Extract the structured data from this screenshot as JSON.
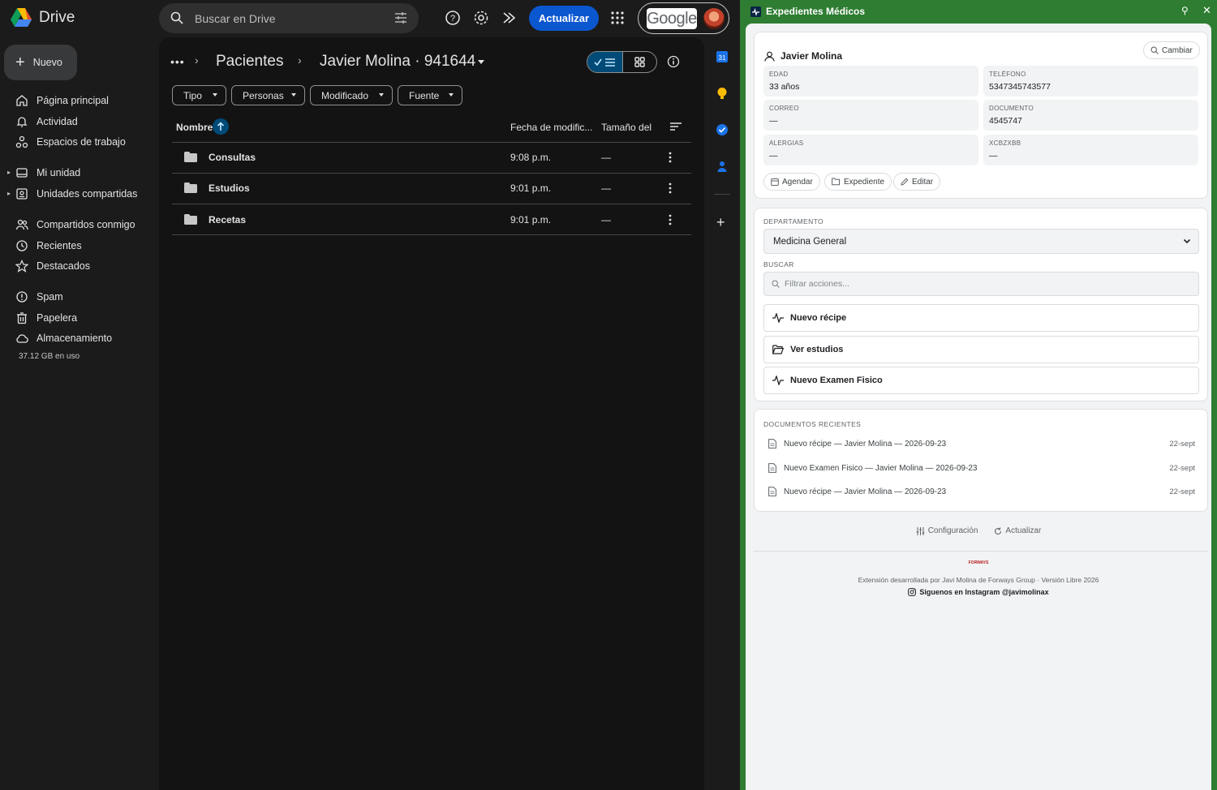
{
  "drive": {
    "app_name": "Drive",
    "search_placeholder": "Buscar en Drive",
    "update_button": "Actualizar",
    "account_label": "Google",
    "new_button": "Nuevo",
    "nav": [
      {
        "label": "Página principal",
        "icon": "home-icon"
      },
      {
        "label": "Actividad",
        "icon": "bell-icon"
      },
      {
        "label": "Espacios de trabajo",
        "icon": "workspaces-icon"
      },
      {
        "label": "Mi unidad",
        "icon": "my-drive-icon"
      },
      {
        "label": "Unidades compartidas",
        "icon": "shared-drives-icon"
      },
      {
        "label": "Compartidos conmigo",
        "icon": "people-icon"
      },
      {
        "label": "Recientes",
        "icon": "clock-icon"
      },
      {
        "label": "Destacados",
        "icon": "star-icon"
      },
      {
        "label": "Spam",
        "icon": "spam-icon"
      },
      {
        "label": "Papelera",
        "icon": "trash-icon"
      },
      {
        "label": "Almacenamiento",
        "icon": "cloud-icon"
      }
    ],
    "storage_used": "37.12 GB en uso",
    "breadcrumb": {
      "parent": "Pacientes",
      "current": "Javier Molina · 941644"
    },
    "filters": [
      "Tipo",
      "Personas",
      "Modificado",
      "Fuente"
    ],
    "columns": {
      "name": "Nombre",
      "modified": "Fecha de modific...",
      "size": "Tamaño del a"
    },
    "files": [
      {
        "name": "Consultas",
        "modified": "9:08 p.m.",
        "size": "—"
      },
      {
        "name": "Estudios",
        "modified": "9:01 p.m.",
        "size": "—"
      },
      {
        "name": "Recetas",
        "modified": "9:01 p.m.",
        "size": "—"
      }
    ]
  },
  "panel": {
    "title": "Expedientes Médicos",
    "patient": {
      "name": "Javier Molina",
      "change_button": "Cambiar",
      "fields": [
        {
          "label": "EDAD",
          "value": "33 años"
        },
        {
          "label": "TELÉFONO",
          "value": "5347345743577"
        },
        {
          "label": "CORREO",
          "value": "—"
        },
        {
          "label": "DOCUMENTO",
          "value": "4545747"
        },
        {
          "label": "ALERGIAS",
          "value": "—"
        },
        {
          "label": "XCBZXBB",
          "value": "—"
        }
      ],
      "actions": [
        "Agendar",
        "Expediente",
        "Editar"
      ]
    },
    "department_label": "DEPARTAMENTO",
    "department_value": "Medicina General",
    "search_label": "BUSCAR",
    "search_placeholder": "Filtrar acciones...",
    "actions": [
      {
        "label": "Nuevo récipe",
        "icon": "pulse-icon"
      },
      {
        "label": "Ver estudios",
        "icon": "folder-open-icon"
      },
      {
        "label": "Nuevo Examen Fisico",
        "icon": "pulse-icon"
      }
    ],
    "recent_label": "DOCUMENTOS RECIENTES",
    "recent_docs": [
      {
        "name": "Nuevo récipe — Javier Molina — 2026-09-23",
        "date": "22-sept"
      },
      {
        "name": "Nuevo Examen Fisico — Javier Molina — 2026-09-23",
        "date": "22-sept"
      },
      {
        "name": "Nuevo récipe — Javier Molina — 2026-09-23",
        "date": "22-sept"
      }
    ],
    "footer": {
      "config": "Configuración",
      "refresh": "Actualizar",
      "brand": "FORWAYS",
      "credits": "Extensión desarrollada por Javi Molina de Forways Group · Versión Libre 2026",
      "instagram": "Siguenos en Instagram @javimolinax"
    }
  },
  "colors": {
    "drive_bg": "#1b1b1b",
    "main_bg": "#131313",
    "accent_blue": "#0b57d0",
    "panel_green": "#2e7d32"
  }
}
